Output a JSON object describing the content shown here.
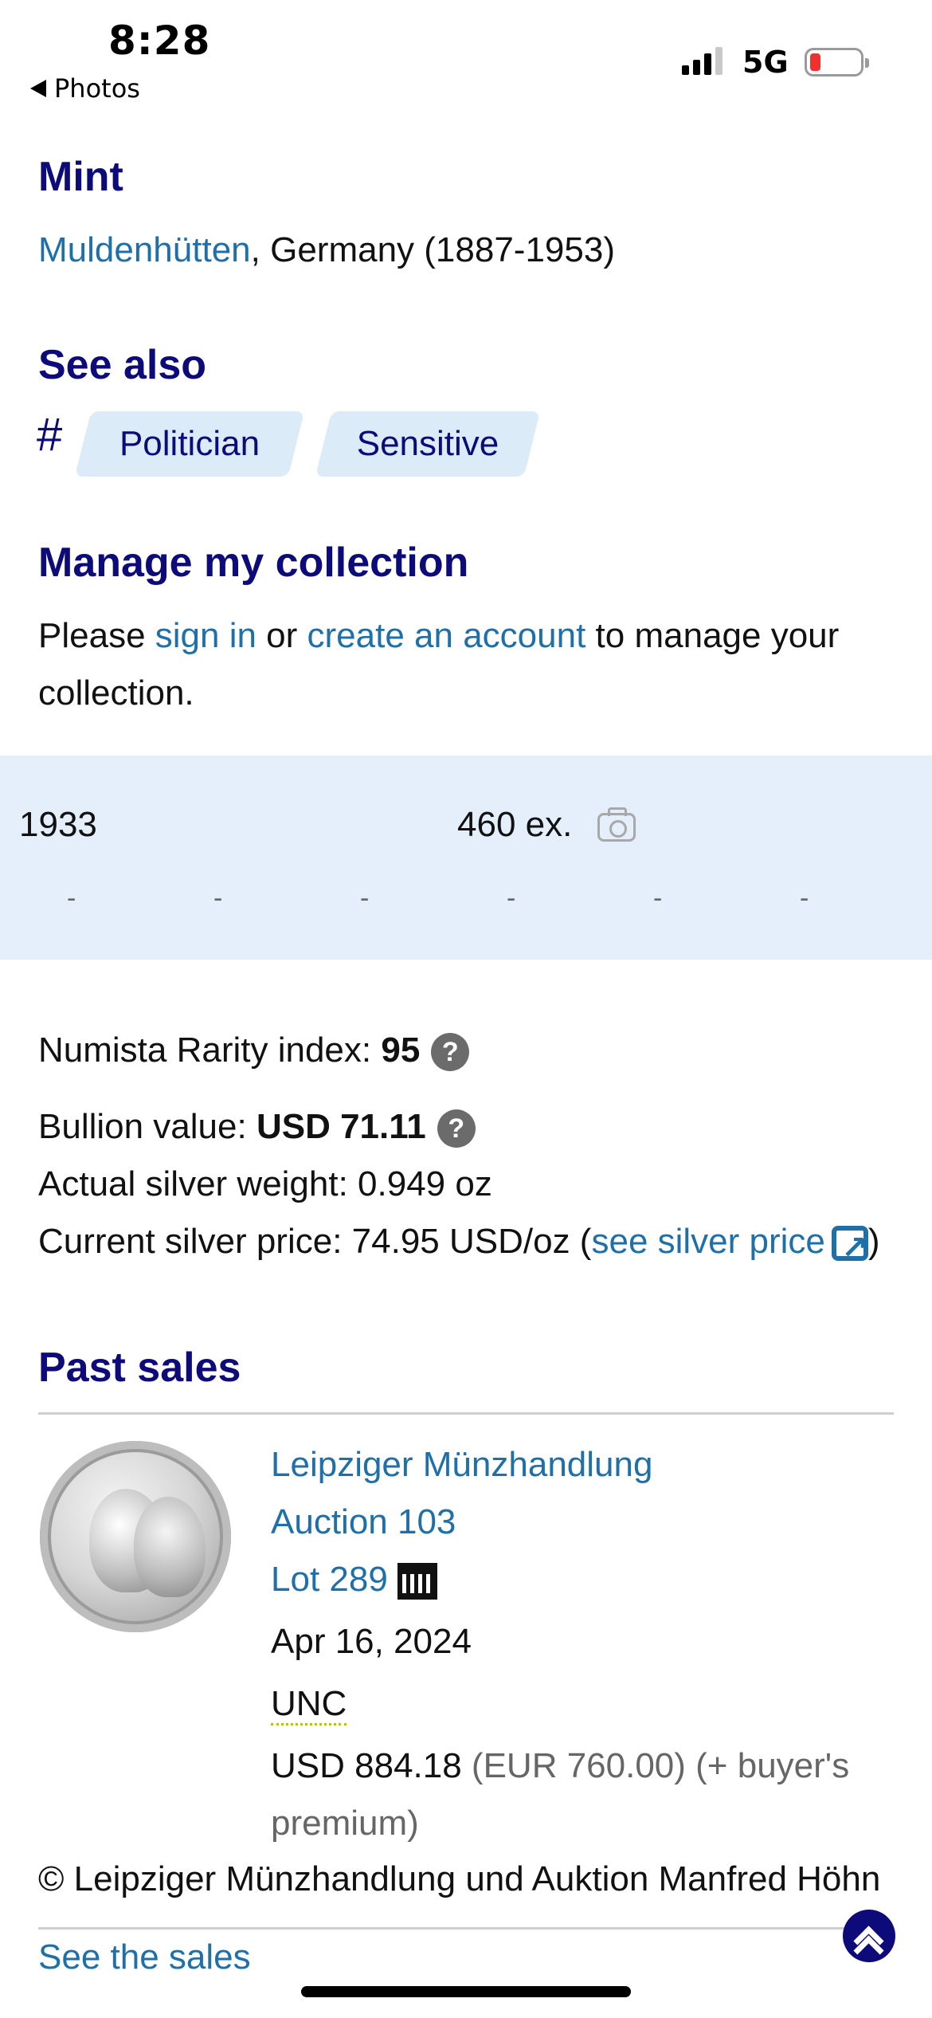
{
  "status_bar": {
    "time": "8:28",
    "back_label": "Photos",
    "network": "5G"
  },
  "mint": {
    "heading": "Mint",
    "place_link": "Muldenhütten",
    "place_rest": ", Germany (1887-1953)"
  },
  "see_also": {
    "heading": "See also",
    "hash": "#",
    "tags": [
      "Politician",
      "Sensitive"
    ]
  },
  "manage": {
    "heading": "Manage my collection",
    "text_1": "Please ",
    "sign_in": "sign in",
    "text_2": " or ",
    "create_account": "create an account",
    "text_3": " to manage your",
    "text_4": "collection."
  },
  "mintage": {
    "year": "1933",
    "quantity": "460 ex.",
    "dashes": [
      "-",
      "-",
      "-",
      "-",
      "-",
      "-"
    ]
  },
  "rarity": {
    "label": "Numista Rarity index: ",
    "value": "95",
    "help": "?"
  },
  "bullion": {
    "label": "Bullion value: ",
    "value": "USD 71.11",
    "help": "?",
    "weight": "Actual silver weight: 0.949 oz",
    "price_text": "Current silver price: 74.95 USD/oz (",
    "price_link": "see silver price",
    "price_close": ")"
  },
  "past_sales": {
    "heading": "Past sales",
    "seller": "Leipziger Münzhandlung",
    "auction": "Auction 103",
    "lot": "Lot 289",
    "date": "Apr 16, 2024",
    "grade": "UNC",
    "price_usd": "USD 884.18",
    "price_eur": " (EUR 760.00) (+ buyer's",
    "premium": "premium)",
    "copyright": "© Leipziger Münzhandlung und Auktion Manfred Höhn",
    "see_sales": "See the sales"
  },
  "colors": {
    "heading": "#0d0a7a",
    "link": "#1f6fa8",
    "band": "#e4effb",
    "tag": "#dcebf8"
  }
}
